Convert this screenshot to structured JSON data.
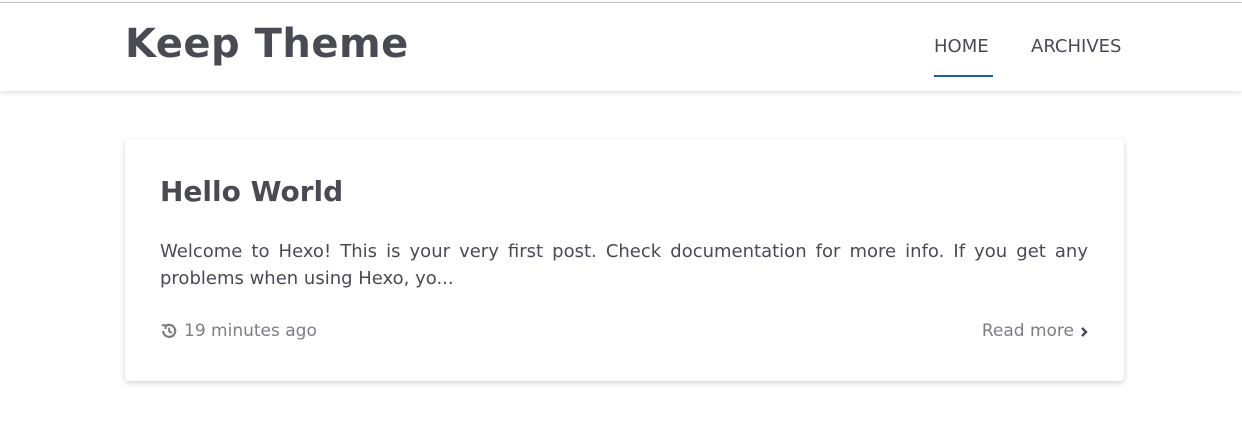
{
  "header": {
    "site_title": "Keep Theme",
    "nav": [
      {
        "label": "HOME",
        "active": true
      },
      {
        "label": "ARCHIVES",
        "active": false
      }
    ],
    "accent_color": "#1e5f9e"
  },
  "post": {
    "title": "Hello World",
    "excerpt": "Welcome to Hexo! This is your very first post. Check documentation for more info. If you get any problems when using Hexo, yo...",
    "time_icon": "history-icon",
    "time": "19 minutes ago",
    "read_more": "Read more",
    "read_more_icon": "chevron-right-icon"
  }
}
